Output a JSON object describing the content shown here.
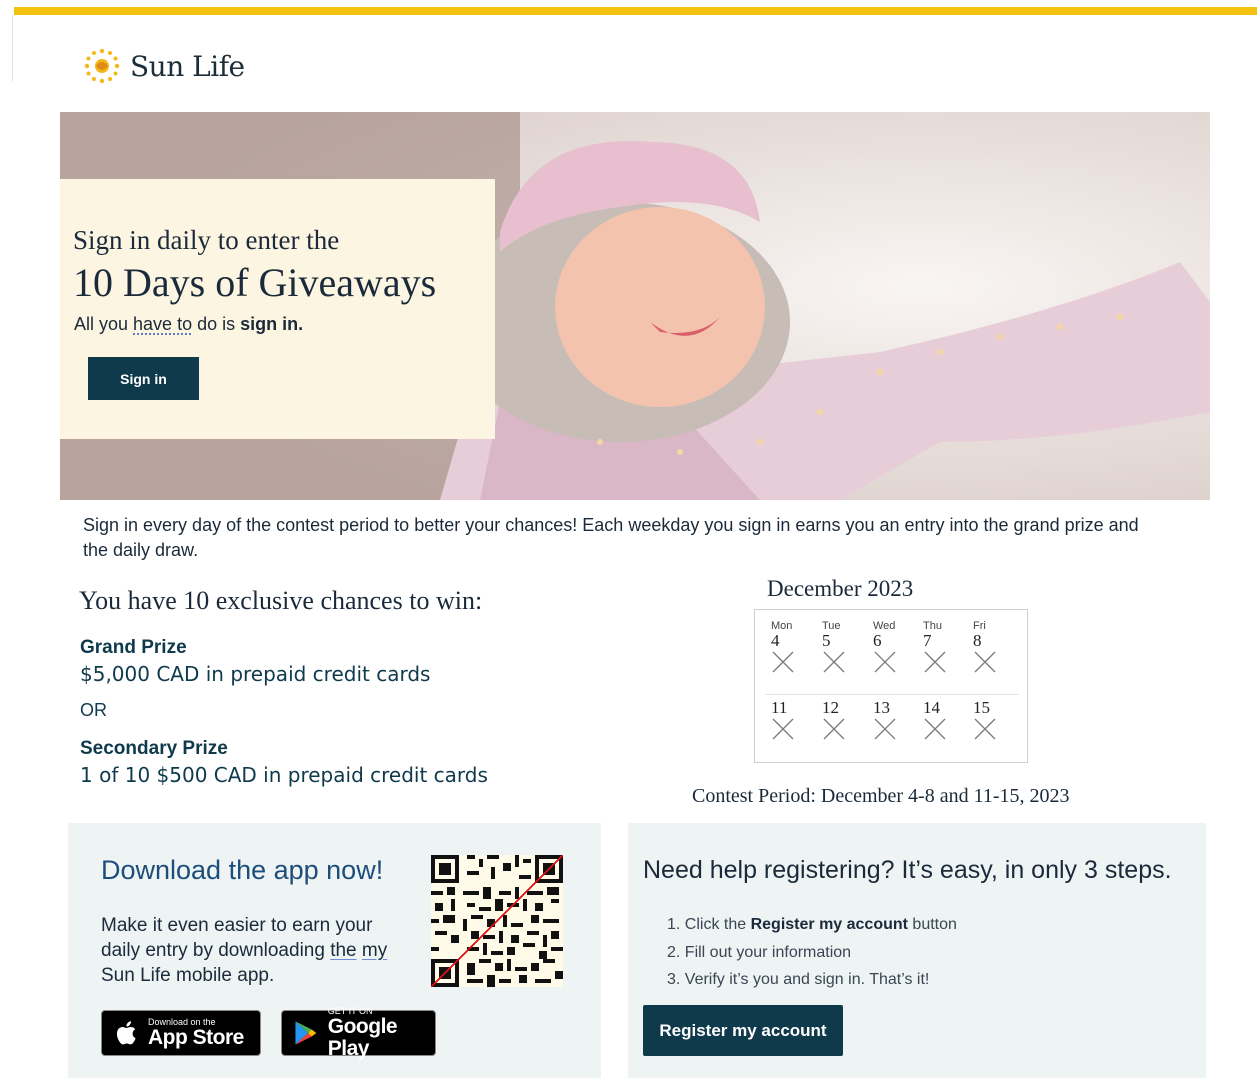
{
  "brand": {
    "name": "Sun Life",
    "colors": {
      "gold": "#f3c20f",
      "navy": "#0f3a4c",
      "cream": "#fbf5e1",
      "panel": "#eef3f4"
    }
  },
  "hero": {
    "intro": "Sign in daily to enter the",
    "title": "10 Days of Giveaways",
    "sub_prefix": "All you ",
    "sub_underlined": "have to",
    "sub_middle": " do is ",
    "sub_bold": "sign in.",
    "button_label": "Sign in"
  },
  "intro_text": "Sign in every day of the contest period to better your chances! Each weekday you sign in earns you an entry into the grand prize and the daily draw.",
  "prizes": {
    "heading": "You have 10 exclusive chances to win:",
    "grand_label": "Grand Prize",
    "grand_desc": "$5,000 CAD in prepaid credit cards",
    "or": "OR",
    "secondary_label": "Secondary Prize",
    "secondary_desc": "1 of 10 $500 CAD in prepaid credit cards"
  },
  "calendar": {
    "title": "December 2023",
    "weekdays": [
      "Mon",
      "Tue",
      "Wed",
      "Thu",
      "Fri"
    ],
    "week1": [
      "4",
      "5",
      "6",
      "7",
      "8"
    ],
    "week2": [
      "11",
      "12",
      "13",
      "14",
      "15"
    ],
    "contest_period": "Contest Period: December 4-8 and 11-15, 2023"
  },
  "download": {
    "title": "Download the app now!",
    "body_1": "Make it even easier to earn your daily entry by downloading ",
    "body_u1": "the",
    "body_2": " ",
    "body_u2": "my",
    "body_3": " Sun Life mobile app.",
    "app_store_small": "Download on the",
    "app_store_big": "App Store",
    "google_small": "GET IT ON",
    "google_big": "Google Play",
    "qr_icon": "qr-code-icon"
  },
  "help": {
    "title": "Need help registering? It’s easy, in only 3 steps.",
    "step1_prefix": "1. Click the ",
    "step1_bold": "Register my account",
    "step1_suffix": " button",
    "step2": "2. Fill out your information",
    "step3": "3. Verify it’s you and sign in. That’s it!",
    "button_label": "Register my account"
  }
}
